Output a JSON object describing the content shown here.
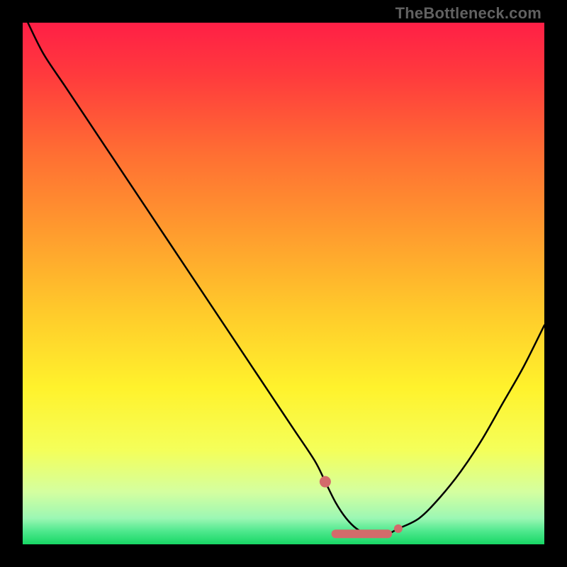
{
  "watermark": "TheBottleneck.com",
  "chart_data": {
    "type": "line",
    "title": "",
    "xlabel": "",
    "ylabel": "",
    "xlim": [
      0,
      100
    ],
    "ylim": [
      0,
      100
    ],
    "series": [
      {
        "name": "bottleneck-curve",
        "x": [
          1,
          4,
          8,
          12,
          16,
          20,
          24,
          28,
          32,
          36,
          40,
          44,
          48,
          52,
          56,
          58,
          60,
          62,
          64,
          66,
          68,
          70,
          72,
          76,
          80,
          84,
          88,
          92,
          96,
          100
        ],
        "values": [
          100,
          94,
          88,
          82,
          76,
          70,
          64,
          58,
          52,
          46,
          40,
          34,
          28,
          22,
          16,
          12,
          8,
          5,
          3,
          2,
          2,
          2,
          3,
          5,
          9,
          14,
          20,
          27,
          34,
          42
        ]
      }
    ],
    "optimal_range_x": [
      58,
      72
    ],
    "gradient_stops": [
      {
        "offset": 0.0,
        "color": "#ff1f46"
      },
      {
        "offset": 0.1,
        "color": "#ff3a3d"
      },
      {
        "offset": 0.25,
        "color": "#ff6e33"
      },
      {
        "offset": 0.4,
        "color": "#ff9b2e"
      },
      {
        "offset": 0.55,
        "color": "#ffc92b"
      },
      {
        "offset": 0.7,
        "color": "#fff22c"
      },
      {
        "offset": 0.82,
        "color": "#f4ff5a"
      },
      {
        "offset": 0.9,
        "color": "#d4ffa0"
      },
      {
        "offset": 0.95,
        "color": "#9cf7b4"
      },
      {
        "offset": 0.975,
        "color": "#4ee88d"
      },
      {
        "offset": 1.0,
        "color": "#17d765"
      }
    ],
    "markers": [
      {
        "x": 58,
        "y": 12,
        "r": 8,
        "color": "#d36b6b"
      },
      {
        "x": 72,
        "y": 3,
        "r": 6,
        "color": "#d36b6b"
      }
    ],
    "optimal_band": {
      "y": 2,
      "x0": 60,
      "x1": 70,
      "stroke": "#d36b6b",
      "width": 12
    }
  }
}
